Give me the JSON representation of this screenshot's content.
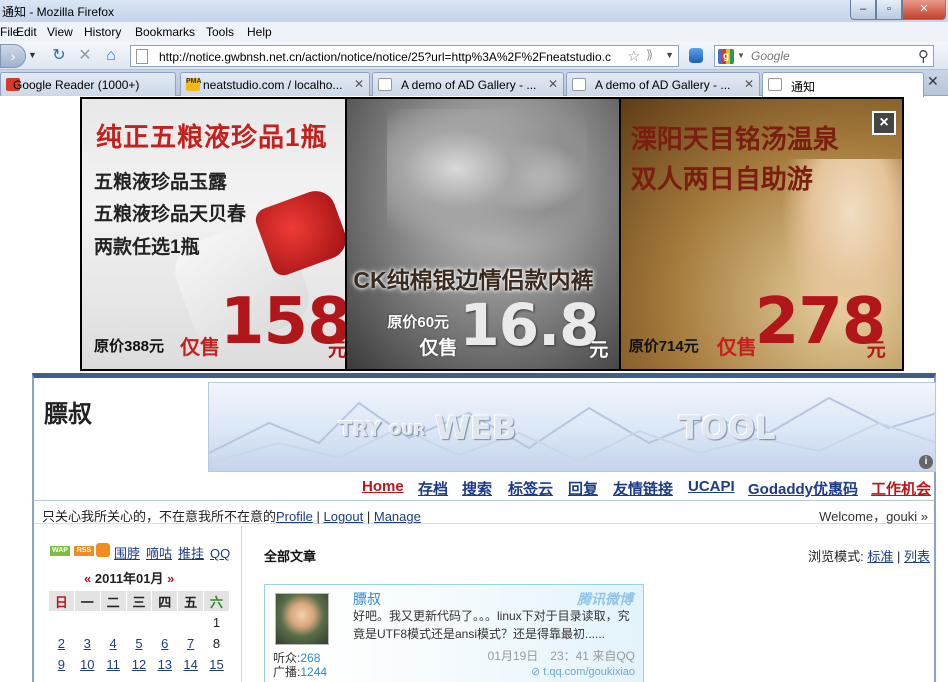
{
  "window": {
    "title": "通知 - Mozilla Firefox"
  },
  "menu": {
    "items": [
      "File",
      "Edit",
      "View",
      "History",
      "Bookmarks",
      "Tools",
      "Help"
    ]
  },
  "navbar": {
    "url": "http://notice.gwbnsh.net.cn/action/notice/notice/25?url=http%3A%2F%2Fneatstudio.c",
    "search_placeholder": "Google"
  },
  "tabs": [
    {
      "label": "Google Reader (1000+)",
      "icon": "google-reader-icon",
      "icon_color": "#d8392b"
    },
    {
      "label": "neatstudio.com / localho...",
      "icon": "phpmyadmin-icon",
      "icon_color": "#f2b81e"
    },
    {
      "label": "A demo of AD Gallery - ...",
      "icon": "page-icon",
      "icon_color": "#ffffff"
    },
    {
      "label": "A demo of AD Gallery - ...",
      "icon": "page-icon",
      "icon_color": "#ffffff"
    },
    {
      "label": "通知",
      "icon": "page-icon",
      "icon_color": "#ffffff",
      "active": true
    }
  ],
  "ads": {
    "ad1": {
      "title": "纯正五粮液珍品1瓶",
      "lines": [
        "五粮液珍品玉露",
        "五粮液珍品天贝春",
        "两款任选1瓶"
      ],
      "original": "原价388元",
      "only": "仅售",
      "price": "158",
      "unit": "元"
    },
    "ad2": {
      "title": "CK纯棉银边情侣款内裤",
      "original": "原价60元",
      "only": "仅售",
      "price": "16.8",
      "unit": "元"
    },
    "ad3": {
      "title1": "溧阳天目铭汤温泉",
      "title2": "双人两日自助游",
      "original": "原价714元",
      "only": "仅售",
      "price": "278",
      "unit": "元"
    },
    "close_label": "×"
  },
  "blog": {
    "title": "膘叔",
    "banner": {
      "w1": "TRY",
      "w2": "OUR",
      "w3": "WEB",
      "w4": "TOOL",
      "info": "i"
    },
    "nav": [
      "Home",
      "存档",
      "搜索",
      "标签云",
      "回复",
      "友情链接",
      "UCAPI",
      "Godaddy优惠码",
      "工作机会"
    ],
    "motto": "只关心我所关心的，不在意我所不在意的",
    "links": [
      "Profile",
      "Logout",
      "Manage"
    ],
    "welcome": "Welcome，gouki »",
    "side": {
      "wap": "WAP",
      "rss": "RSS",
      "links": [
        "围脖",
        "嘀咕",
        "推挂",
        "QQ"
      ],
      "calendar_title": "2011年01月",
      "prev": "«",
      "next": "»",
      "weekdays": [
        "日",
        "一",
        "二",
        "三",
        "四",
        "五",
        "六"
      ],
      "rows": [
        [
          "",
          "",
          "",
          "",
          "",
          "",
          "1"
        ],
        [
          "2",
          "3",
          "4",
          "5",
          "6",
          "7",
          "8"
        ],
        [
          "9",
          "10",
          "11",
          "12",
          "13",
          "14",
          "15"
        ]
      ]
    },
    "main": {
      "section": "全部文章",
      "view_label": "浏览模式:",
      "view_std": "标准",
      "view_list": "列表",
      "weibo": {
        "author": "膘叔",
        "brand": "腾讯微博",
        "text": "好吧。我又更新代码了。。。linux下对于目录读取，究竟是UTF8模式还是ansi模式？还是得靠最初......",
        "fans_label": "听众:",
        "fans": "268",
        "posts_label": "广播:",
        "posts": "1244",
        "time": "01月19日　23：41 来自QQ",
        "source": "t.qq.com/goukixiao"
      }
    }
  }
}
